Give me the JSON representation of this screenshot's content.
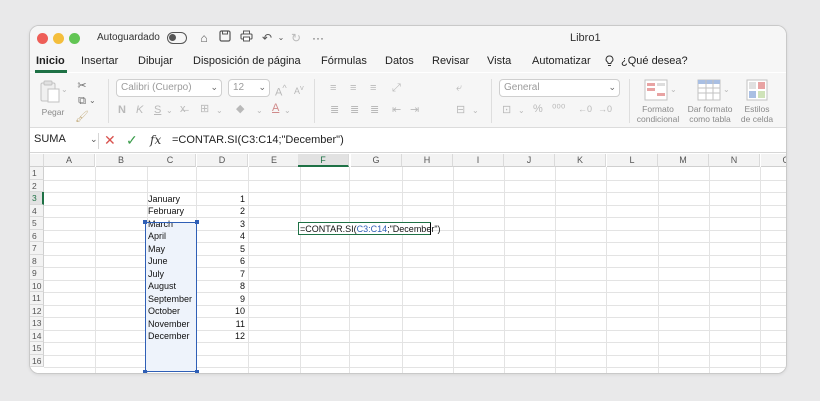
{
  "window": {
    "autosave_label": "Autoguardado",
    "title": "Libro1",
    "titlebar_icons": [
      "home-icon",
      "save-icon",
      "print-icon",
      "undo-icon",
      "redo-icon",
      "more-icon"
    ]
  },
  "menu": {
    "items": [
      "Inicio",
      "Insertar",
      "Dibujar",
      "Disposición de página",
      "Fórmulas",
      "Datos",
      "Revisar",
      "Vista",
      "Automatizar"
    ],
    "active": "Inicio",
    "tell_me": "¿Qué desea?"
  },
  "ribbon": {
    "paste_label": "Pegar",
    "font_name": "Calibri (Cuerpo)",
    "font_size": "12",
    "bold": "N",
    "italic": "K",
    "underline": "S",
    "font_color_letter": "A",
    "number_format": "General",
    "percent": "%",
    "conditional_format": [
      "Formato",
      "condicional"
    ],
    "format_as_table": [
      "Dar formato",
      "como tabla"
    ],
    "cell_styles": [
      "Estilos",
      "de celda"
    ]
  },
  "formula_bar": {
    "name_box": "SUMA",
    "fx": "fx",
    "formula": "=CONTAR.SI(C3:C14;\"December\")"
  },
  "grid": {
    "columns": [
      "A",
      "B",
      "C",
      "D",
      "E",
      "F",
      "G",
      "H",
      "I",
      "J",
      "K",
      "L",
      "M",
      "N",
      "O"
    ],
    "rows": [
      "1",
      "2",
      "3",
      "4",
      "5",
      "6",
      "7",
      "8",
      "9",
      "10",
      "11",
      "12",
      "13",
      "14",
      "15",
      "16"
    ],
    "selected_column": "F",
    "selected_row": "3",
    "months": [
      "January",
      "February",
      "March",
      "April",
      "May",
      "June",
      "July",
      "August",
      "September",
      "October",
      "November",
      "December"
    ],
    "numbers": [
      "1",
      "2",
      "3",
      "4",
      "5",
      "6",
      "7",
      "8",
      "9",
      "10",
      "11",
      "12"
    ],
    "edit_prefix": "=CONTAR.SI(",
    "edit_ref": "C3:C14",
    "edit_suffix": ";\"December\")"
  },
  "colors": {
    "accent_green": "#1e7145",
    "range_blue": "#2f5fb6"
  }
}
